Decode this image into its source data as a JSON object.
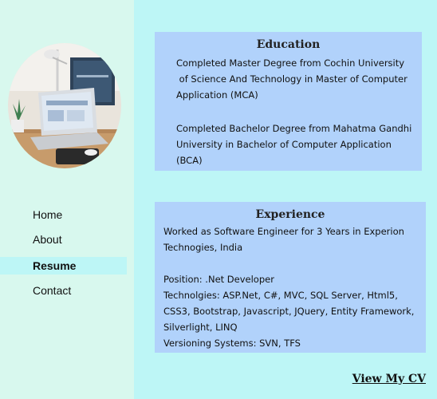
{
  "nav": {
    "items": [
      {
        "label": "Home"
      },
      {
        "label": "About"
      },
      {
        "label": "Resume"
      },
      {
        "label": "Contact"
      }
    ]
  },
  "education": {
    "title": "Education",
    "paragraphs": [
      [
        "Completed Master Degree from Cochin University",
        " of Science And Technology in Master of Computer",
        "Application (MCA)"
      ],
      [
        "Completed Bachelor Degree from Mahatma Gandhi",
        "University in Bachelor of Computer Application",
        "(BCA)"
      ]
    ]
  },
  "experience": {
    "title": "Experience",
    "lines": [
      "Worked as Software Engineer for 3 Years in Experion",
      "Technogies, India",
      "",
      "Position: .Net Developer",
      "Technolgies: ASP.Net, C#, MVC, SQL Server, Html5,",
      "CSS3, Bootstrap, Javascript, JQuery, Entity Framework,",
      "Silverlight, LINQ",
      "Versioning Systems: SVN, TFS"
    ]
  },
  "cv_link": {
    "label": "View My CV"
  },
  "colors": {
    "page_bg": "#bdf6f6",
    "sidebar_bg": "#d8f8ee",
    "card_bg": "#b1d2fb",
    "active_nav_bg": "#bdf6f6"
  }
}
